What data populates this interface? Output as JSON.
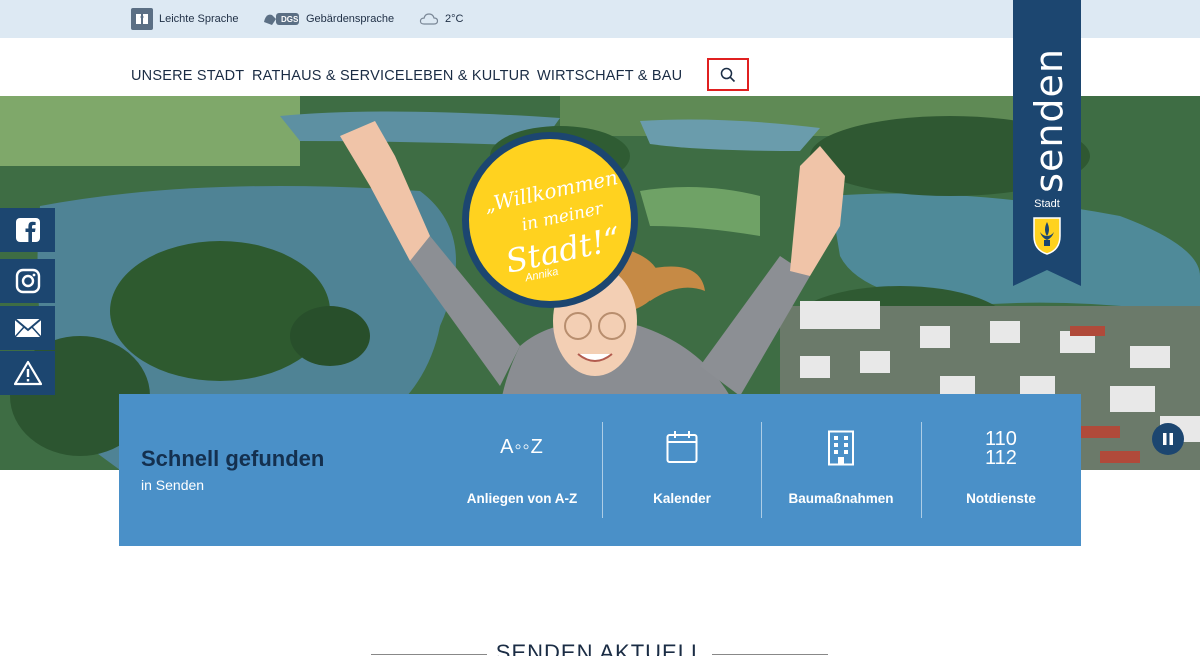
{
  "topbar": {
    "easy_language": "Leichte Sprache",
    "sign_language": "Gebärdensprache",
    "dgs_badge": "DGS",
    "temperature": "2°C"
  },
  "nav": {
    "items": [
      "UNSERE STADT",
      "RATHAUS & SERVICE",
      "LEBEN & KULTUR",
      "WIRTSCHAFT & BAU"
    ]
  },
  "logo": {
    "city": "senden",
    "type": "Stadt"
  },
  "hero": {
    "badge_line1": "„Willkommen",
    "badge_line2": "in meiner",
    "badge_line3": "Stadt!“",
    "badge_signature": "Annika"
  },
  "quick": {
    "title": "Schnell gefunden",
    "subtitle": "in Senden",
    "items": [
      {
        "label": "Anliegen von A-Z",
        "icon": "a-to-z-icon",
        "icon_text": "A◦◦Z"
      },
      {
        "label": "Kalender",
        "icon": "calendar-icon"
      },
      {
        "label": "Baumaßnahmen",
        "icon": "building-icon"
      },
      {
        "label": "Notdienste",
        "icon": "emergency-numbers-icon",
        "icon_line1": "110",
        "icon_line2": "112"
      }
    ]
  },
  "section": {
    "heading": "SENDEN AKTUELL"
  },
  "colors": {
    "topbar": "#dde9f3",
    "navy": "#1c4670",
    "quick_bg": "#4a90c8",
    "badge_yellow": "#ffd21f",
    "search_highlight": "#e02020"
  }
}
